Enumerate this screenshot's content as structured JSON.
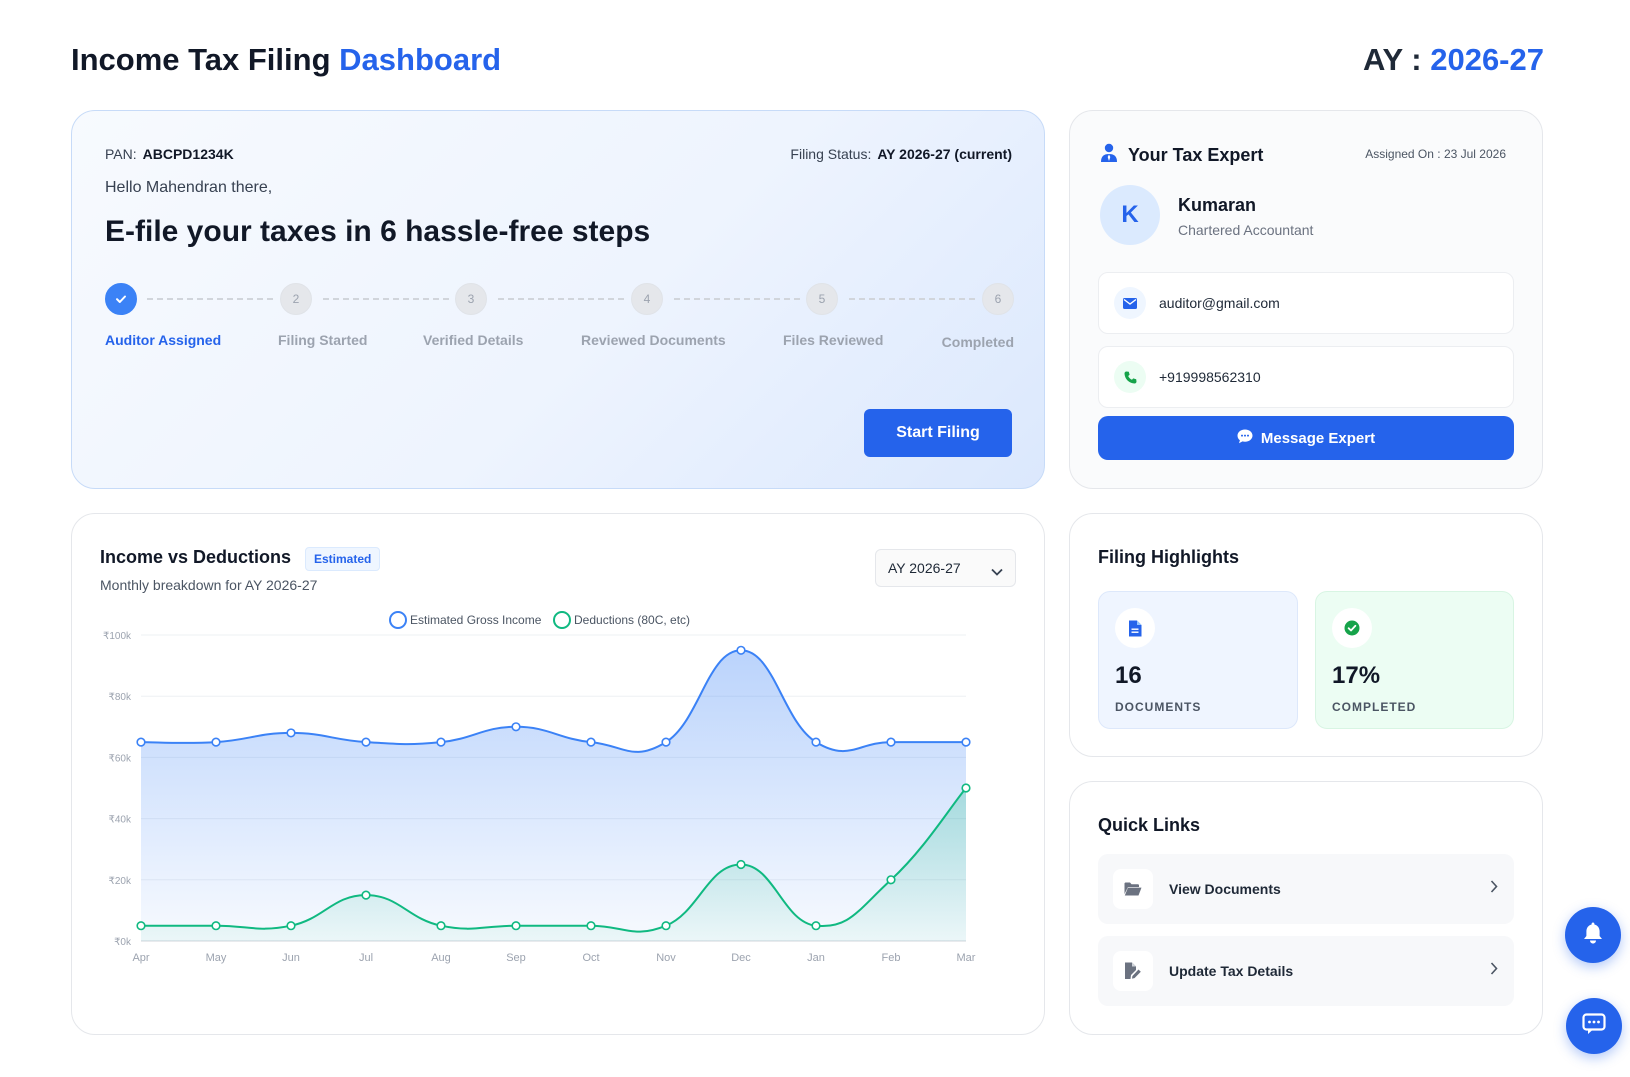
{
  "header": {
    "title_main": "Income Tax Filing",
    "title_accent": "Dashboard",
    "ay_label": "AY :",
    "ay_value": "2026-27"
  },
  "hero": {
    "pan_label": "PAN:",
    "pan_value": "ABCPD1234K",
    "status_label": "Filing Status:",
    "status_value": "AY 2026-27 (current)",
    "greeting": "Hello Mahendran there,",
    "headline": "E-file your taxes in 6 hassle-free steps",
    "steps": [
      {
        "num": "1",
        "label": "Auditor Assigned",
        "done": true
      },
      {
        "num": "2",
        "label": "Filing Started",
        "done": false
      },
      {
        "num": "3",
        "label": "Verified Details",
        "done": false
      },
      {
        "num": "4",
        "label": "Reviewed Documents",
        "done": false
      },
      {
        "num": "5",
        "label": "Files Reviewed",
        "done": false
      },
      {
        "num": "6",
        "label": "Completed",
        "done": false
      }
    ],
    "start_button": "Start Filing"
  },
  "expert": {
    "title": "Your Tax Expert",
    "assigned": "Assigned On : 23 Jul 2026",
    "initial": "K",
    "name": "Kumaran",
    "role": "Chartered Accountant",
    "email": "auditor@gmail.com",
    "phone": "+919998562310",
    "message_button": "Message Expert",
    "icons": [
      "user-tie-icon",
      "envelope-icon",
      "phone-icon",
      "chat-bubble-icon"
    ]
  },
  "chart": {
    "title": "Income vs Deductions",
    "badge": "Estimated",
    "subtitle": "Monthly breakdown for AY 2026-27",
    "select_value": "AY 2026-27"
  },
  "chart_data": {
    "type": "area",
    "categories": [
      "Apr",
      "May",
      "Jun",
      "Jul",
      "Aug",
      "Sep",
      "Oct",
      "Nov",
      "Dec",
      "Jan",
      "Feb",
      "Mar"
    ],
    "series": [
      {
        "name": "Estimated Gross Income",
        "color": "#3b82f6",
        "values": [
          65000,
          65000,
          68000,
          65000,
          65000,
          70000,
          65000,
          65000,
          95000,
          65000,
          65000,
          65000
        ]
      },
      {
        "name": "Deductions (80C, etc)",
        "color": "#10b981",
        "values": [
          5000,
          5000,
          5000,
          15000,
          5000,
          5000,
          5000,
          5000,
          25000,
          5000,
          20000,
          50000
        ]
      }
    ],
    "yticks": [
      "₹0k",
      "₹20k",
      "₹40k",
      "₹60k",
      "₹80k",
      "₹100k"
    ],
    "ylim": [
      0,
      100000
    ],
    "grid": true,
    "legend": "top-center"
  },
  "highlights": {
    "title": "Filing Highlights",
    "documents_value": "16",
    "documents_label": "DOCUMENTS",
    "completed_value": "17%",
    "completed_label": "COMPLETED"
  },
  "quick_links": {
    "title": "Quick Links",
    "items": [
      {
        "label": "View Documents"
      },
      {
        "label": "Update Tax Details"
      }
    ]
  },
  "colors": {
    "primary": "#2563eb",
    "income": "#3b82f6",
    "deduction": "#10b981"
  }
}
